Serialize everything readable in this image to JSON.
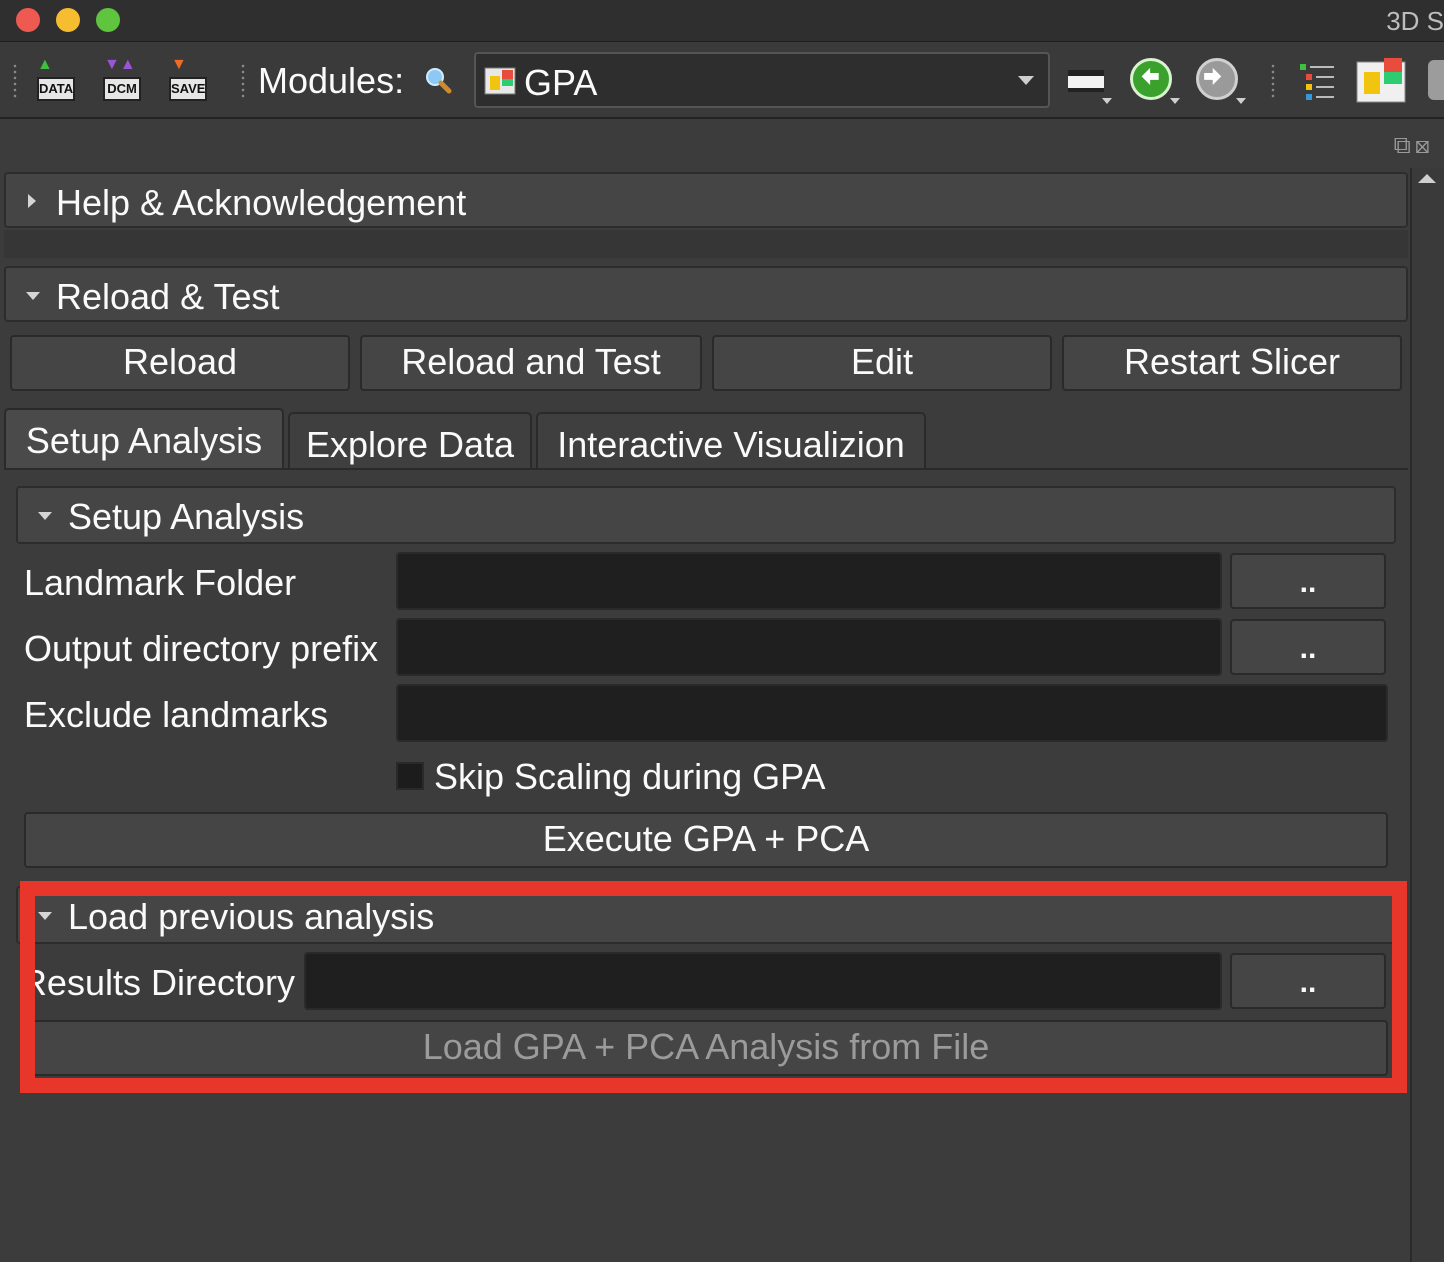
{
  "window": {
    "title": "3D S"
  },
  "toolbar": {
    "data_icon_label": "DATA",
    "dcm_icon_label": "DCM",
    "save_icon_label": "SAVE",
    "modules_label": "Modules:",
    "module_selected": "GPA"
  },
  "sections": {
    "help": {
      "label": "Help & Acknowledgement"
    },
    "reload_test": {
      "label": "Reload & Test",
      "buttons": {
        "reload": "Reload",
        "reload_and_test": "Reload and Test",
        "edit": "Edit",
        "restart": "Restart Slicer"
      }
    }
  },
  "tabs": {
    "setup": "Setup Analysis",
    "explore": "Explore Data",
    "interactive": "Interactive Visualizion"
  },
  "setup_analysis": {
    "header": "Setup Analysis",
    "landmark_folder_label": "Landmark Folder",
    "landmark_folder_value": "",
    "output_prefix_label": "Output directory prefix",
    "output_prefix_value": "",
    "exclude_label": "Exclude landmarks",
    "exclude_value": "",
    "browse_label": "..",
    "skip_scaling_label": "Skip Scaling during GPA",
    "skip_scaling_checked": false,
    "execute_label": "Execute GPA + PCA"
  },
  "load_previous": {
    "header": "Load previous analysis",
    "results_dir_label": "Results Directory",
    "results_dir_value": "",
    "browse_label": "..",
    "load_button_label": "Load GPA + PCA Analysis from File"
  },
  "colors": {
    "highlight": "#e8372a",
    "background": "#3c3c3c",
    "field": "#1f1f1f"
  }
}
